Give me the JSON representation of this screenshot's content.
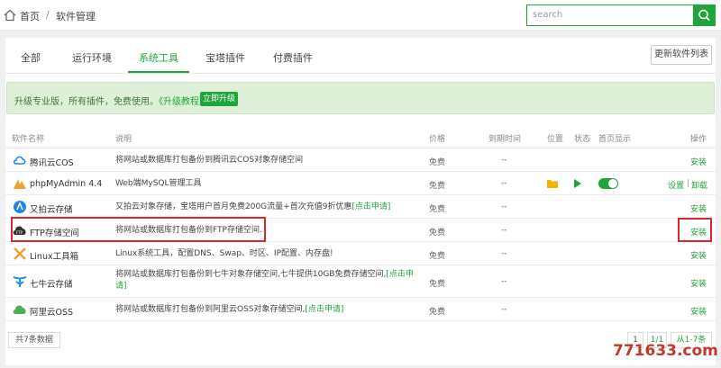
{
  "breadcrumb": {
    "home": "首页",
    "separator": "/",
    "current": "软件管理"
  },
  "search": {
    "placeholder": "search"
  },
  "tabs": [
    {
      "label": "全部",
      "active": false
    },
    {
      "label": "运行环境",
      "active": false
    },
    {
      "label": "系统工具",
      "active": true
    },
    {
      "label": "宝塔插件",
      "active": false
    },
    {
      "label": "付费插件",
      "active": false
    }
  ],
  "update_button": "更新软件列表",
  "promo": {
    "text": "升级专业版，所有插件，免费使用。",
    "link": "《升级教程》",
    "button": "立即升级"
  },
  "table": {
    "headers": {
      "name": "软件名称",
      "desc": "说明",
      "price": "价格",
      "expire": "到期时间",
      "position": "位置",
      "status": "状态",
      "home_show": "首页显示",
      "action": "操作"
    },
    "rows": [
      {
        "icon": "tencent-cloud-icon",
        "name": "腾讯云COS",
        "desc": "将网站或数据库打包备份到腾讯云COS对象存储空间",
        "price": "免费",
        "expire": "--",
        "action": "安装"
      },
      {
        "icon": "phpmyadmin-icon",
        "name": "phpMyAdmin 4.4",
        "desc": "Web端MySQL管理工具",
        "price": "免费",
        "expire": "--",
        "action_settings": "设置",
        "action_sep": "|",
        "action_uninstall": "卸载"
      },
      {
        "icon": "upyun-icon",
        "name": "又拍云存储",
        "desc": "又拍云对象存储，宝塔用户首月免费200G流量+首次充值9折优惠",
        "link": "[点击申请]",
        "price": "免费",
        "expire": "--",
        "action": "安装"
      },
      {
        "icon": "ftp-icon",
        "name": "FTP存储空间",
        "desc": "将网站或数据库打包备份到FTP存储空间.",
        "price": "免费",
        "expire": "--",
        "action": "安装"
      },
      {
        "icon": "linux-tools-icon",
        "name": "Linux工具箱",
        "desc": "Linux系统工具，配置DNS、Swap、时区、IP配置、内存盘!",
        "price": "免费",
        "expire": "--",
        "action": "安装"
      },
      {
        "icon": "qiniu-icon",
        "name": "七牛云存储",
        "desc": "将网站或数据库打包备份到七牛对象存储空间,七牛提供10GB免费存储空间,",
        "link_a": "[点击申",
        "link_b": "请]",
        "price": "免费",
        "expire": "--",
        "action": "安装"
      },
      {
        "icon": "aliyun-icon",
        "name": "阿里云OSS",
        "desc": "将网站或数据库打包备份到阿里云OSS对象存储空间,",
        "link": "[点击申请]",
        "price": "免费",
        "expire": "--",
        "action": "安装"
      }
    ]
  },
  "footer": {
    "total": "共7条数据",
    "page": "1",
    "page_of": "1/1",
    "range": "从1-7条"
  },
  "watermark": "771633.com",
  "colors": {
    "accent": "#20a53a",
    "highlight": "#d9272e"
  }
}
